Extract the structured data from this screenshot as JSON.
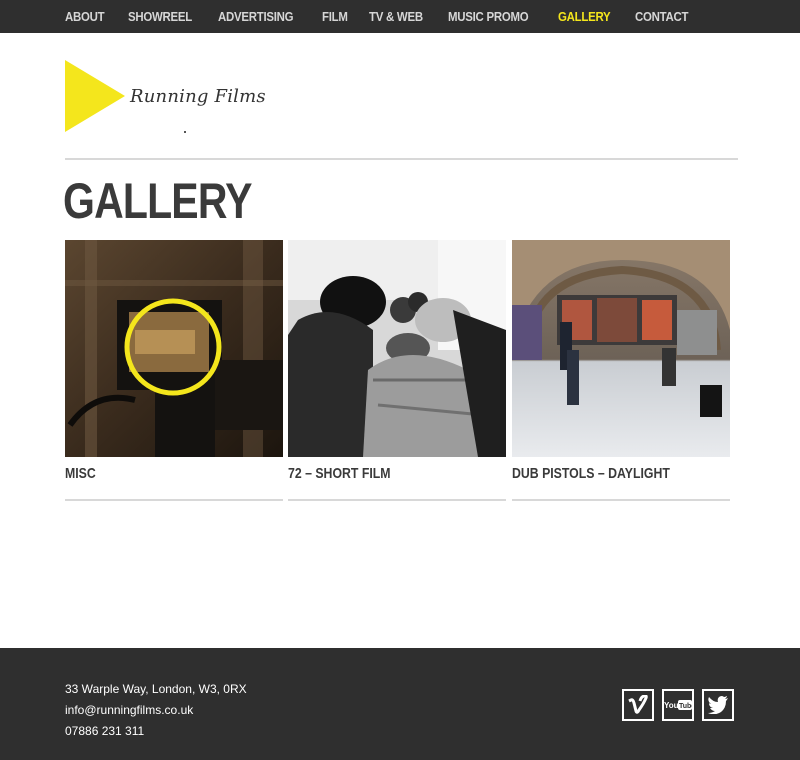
{
  "nav": {
    "items": [
      "ABOUT",
      "SHOWREEL",
      "ADVERTISING",
      "FILM",
      "TV & WEB",
      "MUSIC PROMO",
      "GALLERY",
      "CONTACT"
    ],
    "active": "GALLERY"
  },
  "logo": {
    "text": "Running Films",
    "icon": "play-triangle-icon",
    "color": "#f4e61c"
  },
  "page": {
    "title": "GALLERY"
  },
  "gallery": [
    {
      "caption": "MISC",
      "image": "camera-monitor-photo"
    },
    {
      "caption": "72 – SHORT FILM",
      "image": "film-crew-photo"
    },
    {
      "caption": "DUB PISTOLS – DAYLIGHT",
      "image": "skate-tunnel-photo"
    }
  ],
  "footer": {
    "address": "33 Warple Way, London, W3, 0RX",
    "email": "info@runningfilms.co.uk",
    "phone": "07886 231 311",
    "social": [
      "vimeo-icon",
      "youtube-icon",
      "twitter-icon"
    ],
    "youtube_label": "You Tube"
  },
  "colors": {
    "accent": "#f4e61c",
    "dark_bar": "#2f2f2f",
    "text": "#3a3a3a"
  }
}
